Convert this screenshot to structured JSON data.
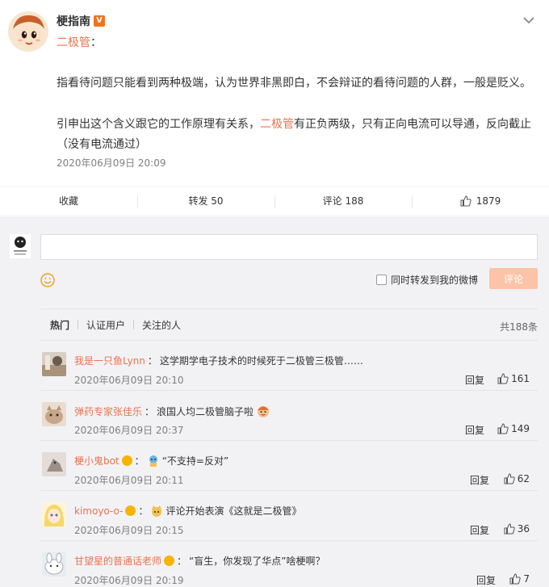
{
  "post": {
    "author": "梗指南",
    "topic_tag": "二极管",
    "topic_colon": "：",
    "paragraph1": "指看待问题只能看到两种极端，认为世界非黑即白，不会辩证的看待问题的人群，一般是贬义。",
    "paragraph2_before": "引申出这个含义跟它的工作原理有关系，",
    "paragraph2_highlight": "二极管",
    "paragraph2_after": "有正负两级，只有正向电流可以导通，反向截止（没有电流通过）",
    "time": "2020年06月09日 20:09"
  },
  "actions": {
    "favorite": "收藏",
    "repost": "转发 50",
    "comment": "评论 188",
    "like_count": "1879"
  },
  "composer": {
    "forward_label": "同时转发到我的微博",
    "submit_label": "评论"
  },
  "filters": {
    "hot": "热门",
    "verified": "认证用户",
    "following": "关注的人",
    "total": "共188条"
  },
  "comments": [
    {
      "user": "我是一只鱼Lynn",
      "sep": "：",
      "text": "这学期学电子技术的时候死于二极管三极管……",
      "time": "2020年06月09日 20:10",
      "reply": "回复",
      "likes": "161"
    },
    {
      "user": "弹药专家张佳乐",
      "sep": "：",
      "text": "浪国人均二极管脑子啦",
      "time": "2020年06月09日 20:37",
      "reply": "回复",
      "likes": "149"
    },
    {
      "user": "梗小鬼bot",
      "sep": "：",
      "text": "“不支持=反对”",
      "time": "2020年06月09日 20:11",
      "reply": "回复",
      "likes": "62"
    },
    {
      "user": "kimoyo-o-",
      "sep": "：",
      "text": "评论开始表演《这就是二极管》",
      "time": "2020年06月09日 20:15",
      "reply": "回复",
      "likes": "36"
    },
    {
      "user": "甘望星的普通话老师",
      "sep": "：",
      "text": "“盲生，你发现了华点”啥梗啊？",
      "time": "2020年06月09日 20:19",
      "reply": "回复",
      "likes": "7"
    }
  ],
  "colors": {
    "accent": "#eb7350",
    "submit_bg": "#fbc4a8",
    "panel_bg": "#f2f2f5"
  }
}
